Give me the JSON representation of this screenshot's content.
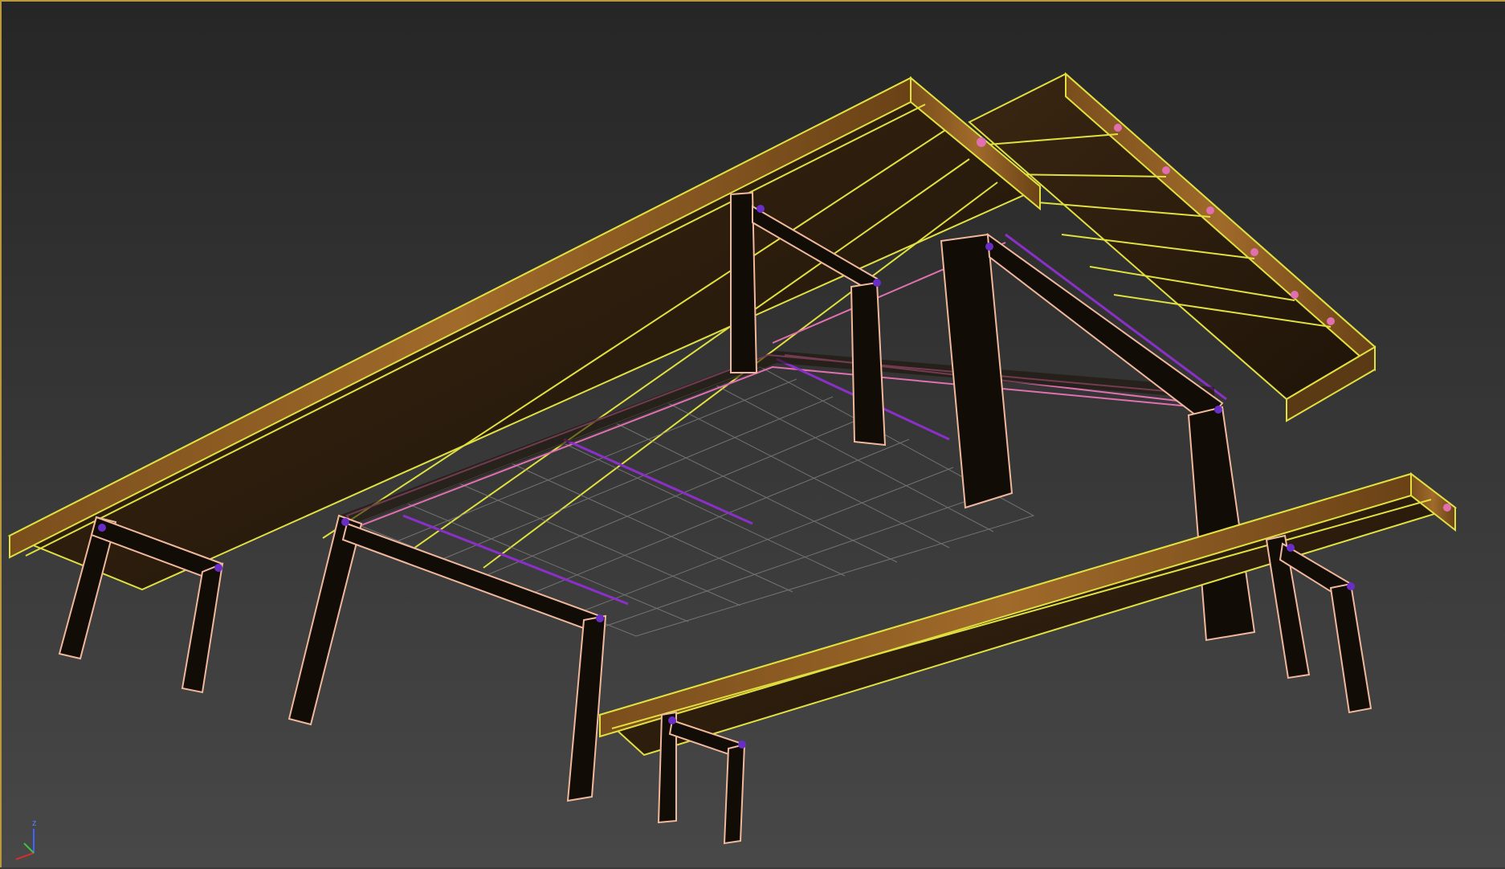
{
  "viewport": {
    "axis_gizmo": {
      "z": "z",
      "x": "x",
      "y": "y"
    },
    "colors": {
      "background_top": "#262626",
      "background_bottom": "#484848",
      "selection_wire": "#e0e040",
      "leg_wire": "#f0b89a",
      "vertex": "#6a2ec8",
      "joint_pink": "#e070b0",
      "wood_dark": "#2e1e0e",
      "wood_light": "#8a5a22",
      "grid": "#8a8a8a",
      "border": "#b89a3c"
    },
    "objects": [
      "table-top",
      "table-frame",
      "grid-plane",
      "bench-left",
      "bench-right",
      "bench-front"
    ]
  }
}
